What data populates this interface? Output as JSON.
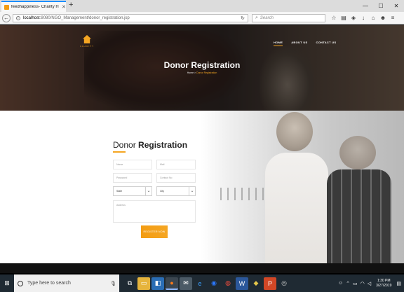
{
  "browser": {
    "tab_title": "feedhappiness- Charity H...",
    "url_host": "localhost",
    "url_path": ":8080/NGO_Management/donor_registration.jsp",
    "search_placeholder": "Search"
  },
  "site": {
    "logo_text": "CHARITY",
    "nav": [
      "HOME",
      "ABOUT US",
      "CONTACT US"
    ],
    "hero_title": "Donor Registration",
    "crumb_home": "Home",
    "crumb_sep": " > ",
    "crumb_current": "Donor Registration"
  },
  "form": {
    "title_light": "Donor ",
    "title_bold": "Registration",
    "name_placeholder": "Name",
    "email_placeholder": "Mail",
    "password_placeholder": "Password",
    "contact_placeholder": "Contact No",
    "state_value": "State",
    "city_value": "City",
    "address_placeholder": "Address",
    "submit_label": "REGISTER NOW"
  },
  "taskbar": {
    "search_text": "Type here to search",
    "time": "1:30 PM",
    "date": "3/27/2019"
  },
  "colors": {
    "accent": "#f5a623"
  }
}
